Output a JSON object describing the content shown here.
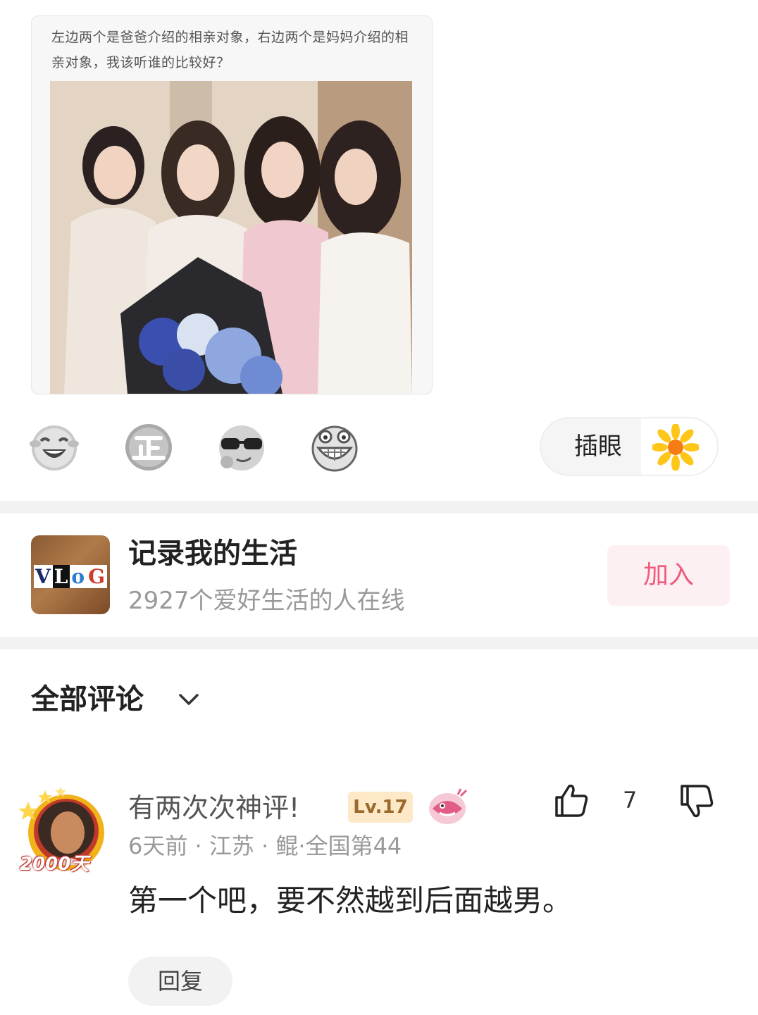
{
  "post": {
    "caption": "左边两个是爸爸介绍的相亲对象，右边两个是妈妈介绍的相亲对象，我该听谁的比较好？",
    "image_alt": "四位女士合影照片"
  },
  "reactions": [
    {
      "icon": "laugh-cry-emoji-icon"
    },
    {
      "icon": "zheng-badge-icon"
    },
    {
      "icon": "sunglasses-emoji-icon"
    },
    {
      "icon": "grin-emoji-icon"
    }
  ],
  "poke": {
    "label": "插眼",
    "icon": "sunflower-icon"
  },
  "group": {
    "avatar_text": "VLOG",
    "title": "记录我的生活",
    "subtitle": "2927个爱好生活的人在线",
    "join_label": "加入"
  },
  "comments_header": {
    "title": "全部评论"
  },
  "comment": {
    "username": "有两次次神评!",
    "level": "Lv.17",
    "meta": "6天前 · 江苏 · 鲲·全国第44",
    "avatar_badge": "2000天",
    "text": "第一个吧，要不然越到后面越男。",
    "like_count": "7",
    "reply_label": "回复"
  },
  "colors": {
    "accent": "#f05b7d",
    "badge_bg": "#fde9c8",
    "muted": "#999999"
  }
}
